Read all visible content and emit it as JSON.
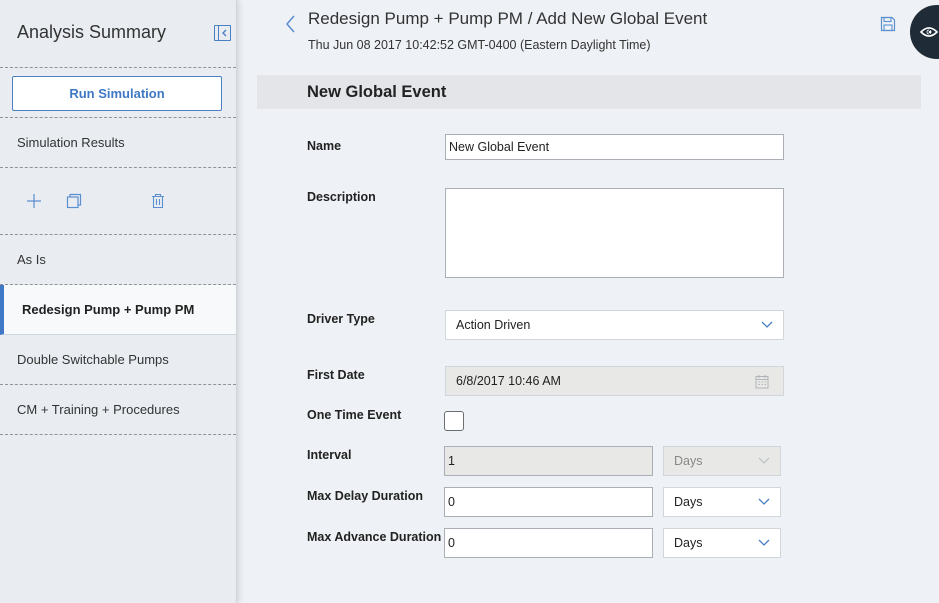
{
  "sidebar": {
    "title": "Analysis Summary",
    "run_button": "Run Simulation",
    "results_label": "Simulation Results",
    "scenarios": [
      {
        "label": "As Is"
      },
      {
        "label": "Redesign Pump + Pump PM"
      },
      {
        "label": "Double Switchable Pumps"
      },
      {
        "label": "CM + Training + Procedures"
      }
    ]
  },
  "header": {
    "title": "Redesign Pump + Pump PM / Add New Global Event",
    "timestamp": "Thu Jun 08 2017 10:42:52 GMT-0400 (Eastern Daylight Time)"
  },
  "form": {
    "section_title": "New Global Event",
    "name_label": "Name",
    "name_value": "New Global Event",
    "description_label": "Description",
    "description_value": "",
    "driver_type_label": "Driver Type",
    "driver_type_value": "Action Driven",
    "first_date_label": "First Date",
    "first_date_value": "6/8/2017 10:46 AM",
    "one_time_label": "One Time Event",
    "one_time_checked": false,
    "interval_label": "Interval",
    "interval_value": "1",
    "interval_unit": "Days",
    "max_delay_label": "Max Delay Duration",
    "max_delay_value": "0",
    "max_delay_unit": "Days",
    "max_advance_label": "Max Advance Duration",
    "max_advance_value": "0",
    "max_advance_unit": "Days"
  },
  "colors": {
    "accent": "#3f78c4",
    "sidebar_bg": "#e9edf2",
    "main_bg": "#eef1f5",
    "fab_bg": "#1f2b36"
  },
  "icons": [
    "collapse-panel-icon",
    "plus-icon",
    "copy-icon",
    "trash-icon",
    "back-chevron-icon",
    "save-icon",
    "eye-icon",
    "calendar-icon",
    "chevron-down-icon"
  ]
}
